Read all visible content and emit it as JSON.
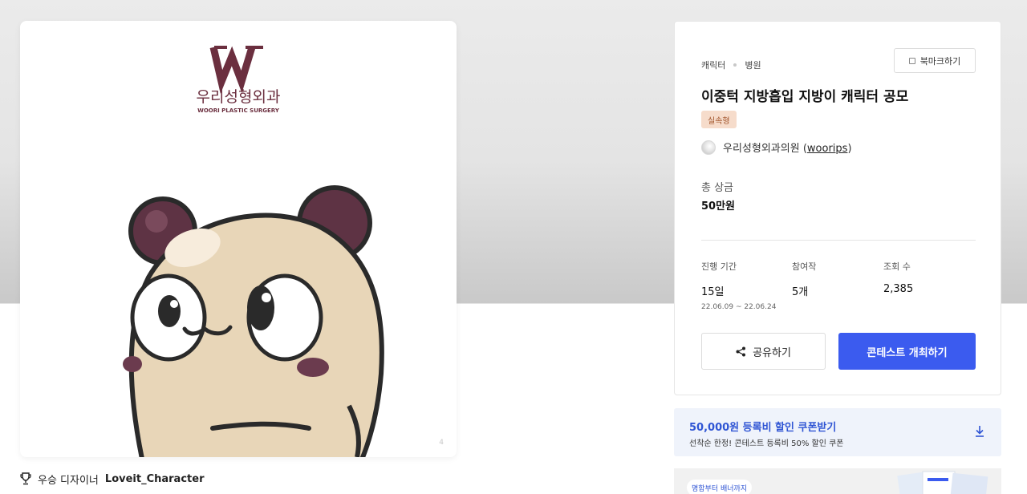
{
  "artwork": {
    "logo_text": "우리성형외과",
    "logo_sub": "WOORI PLASTIC SURGERY"
  },
  "winner": {
    "prefix": "우승 디자이너",
    "name": "Loveit_Character"
  },
  "breadcrumb": [
    "캐릭터",
    "병원"
  ],
  "bookmark_label": "북마크하기",
  "title": "이중턱 지방흡입 지방이 캐릭터 공모",
  "badge": "실속형",
  "host": {
    "name": "우리성형외과의원",
    "handle": "woorips"
  },
  "prize": {
    "label": "총 상금",
    "value": "50만원"
  },
  "stats": [
    {
      "label": "진행 기간",
      "value": "15일",
      "sub": "22.06.09 ~ 22.06.24"
    },
    {
      "label": "참여작",
      "value": "5개"
    },
    {
      "label": "조회 수",
      "value": "2,385"
    }
  ],
  "buttons": {
    "share": "공유하기",
    "host_contest": "콘테스트 개최하기"
  },
  "coupon": {
    "title": "50,000원 등록비 할인 쿠폰받기",
    "desc": "선착순 한정! 콘테스트 등록비 50% 할인 쿠폰"
  },
  "promo": {
    "tag": "명함부터 배너까지"
  },
  "colors": {
    "primary": "#3b5bef",
    "coupon_text": "#2f55d4",
    "badge_bg": "#f6dccb",
    "logo": "#6b2f3f"
  }
}
